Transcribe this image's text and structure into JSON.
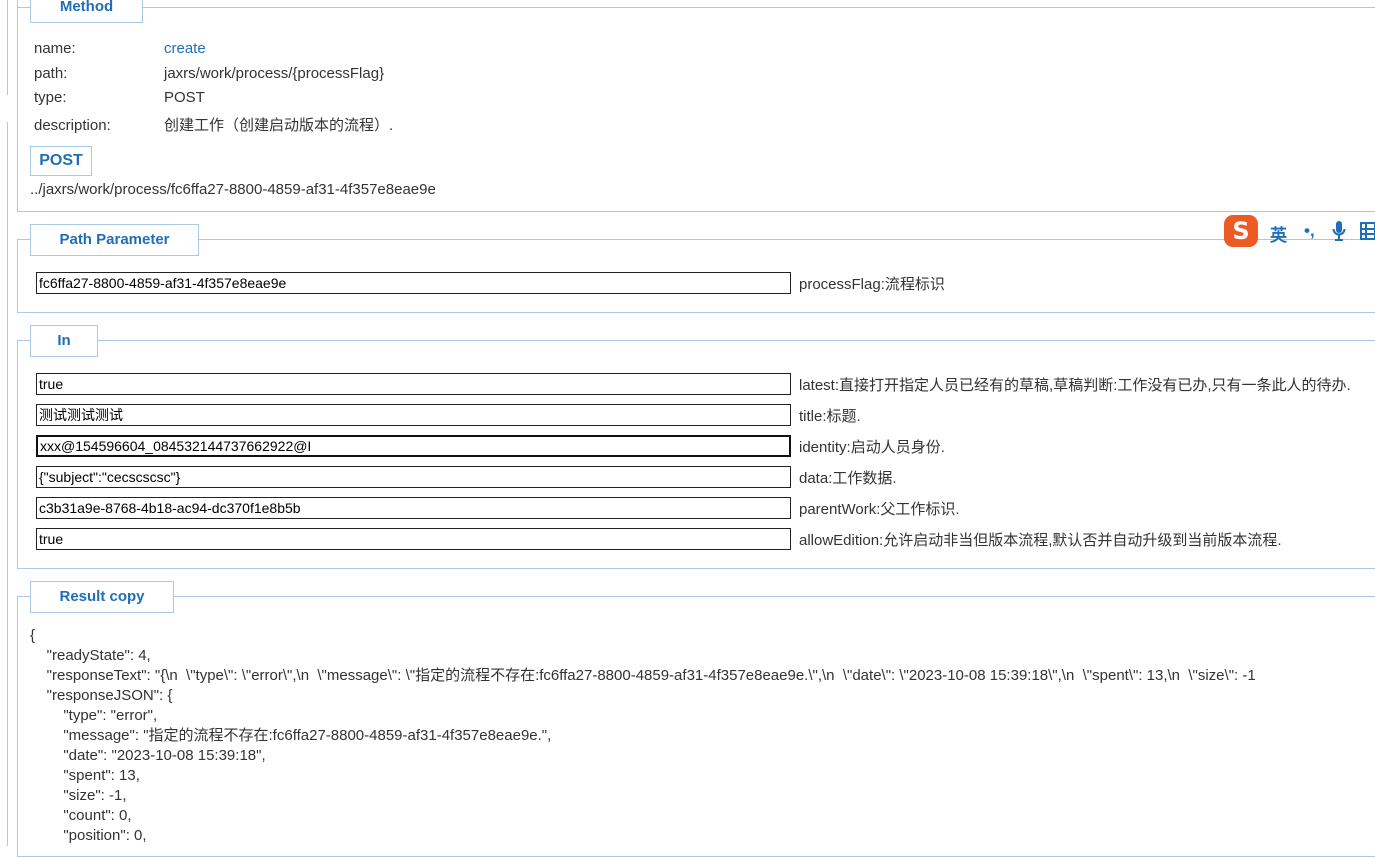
{
  "method": {
    "legend": "Method",
    "rows": [
      {
        "key": "name:",
        "value": "create"
      },
      {
        "key": "path:",
        "value": "jaxrs/work/process/{processFlag}"
      },
      {
        "key": "type:",
        "value": "POST"
      },
      {
        "key": "description:",
        "value": "创建工作（创建启动版本的流程）."
      }
    ],
    "badge": "POST",
    "url": "../jaxrs/work/process/fc6ffa27-8800-4859-af31-4f357e8eae9e"
  },
  "path_parameter": {
    "legend": "Path Parameter",
    "fields": [
      {
        "value": "fc6ffa27-8800-4859-af31-4f357e8eae9e",
        "desc": "processFlag:流程标识"
      }
    ]
  },
  "in": {
    "legend": "In",
    "fields": [
      {
        "value": "true",
        "desc": "latest:直接打开指定人员已经有的草稿,草稿判断:工作没有已办,只有一条此人的待办."
      },
      {
        "value": "测试测试测试",
        "desc": "title:标题."
      },
      {
        "value": "xxx@154596604_084532144737662922@I",
        "desc": "identity:启动人员身份."
      },
      {
        "value": "{\"subject\":\"cecscscsc\"}",
        "desc": "data:工作数据."
      },
      {
        "value": "c3b31a9e-8768-4b18-ac94-dc370f1e8b5b",
        "desc": "parentWork:父工作标识."
      },
      {
        "value": "true",
        "desc": "allowEdition:允许启动非当但版本流程,默认否并自动升级到当前版本流程."
      }
    ]
  },
  "result": {
    "legend": "Result copy",
    "lines": [
      "{",
      "    \"readyState\": 4,",
      "    \"responseText\": \"{\\n  \\\"type\\\": \\\"error\\\",\\n  \\\"message\\\": \\\"指定的流程不存在:fc6ffa27-8800-4859-af31-4f357e8eae9e.\\\",\\n  \\\"date\\\": \\\"2023-10-08 15:39:18\\\",\\n  \\\"spent\\\": 13,\\n  \\\"size\\\": -1",
      "    \"responseJSON\": {",
      "        \"type\": \"error\",",
      "        \"message\": \"指定的流程不存在:fc6ffa27-8800-4859-af31-4f357e8eae9e.\",",
      "        \"date\": \"2023-10-08 15:39:18\",",
      "        \"spent\": 13,",
      "        \"size\": -1,",
      "        \"count\": 0,",
      "        \"position\": 0,"
    ]
  },
  "ime": {
    "logo": "S",
    "lang": "英",
    "punct": "•,",
    "mic_icon": "microphone-icon",
    "grid_icon": "keyboard-grid-icon"
  },
  "colors": {
    "accent": "#1f6fb8",
    "border": "#a9c9e6",
    "ime_logo": "#ee5a24"
  }
}
